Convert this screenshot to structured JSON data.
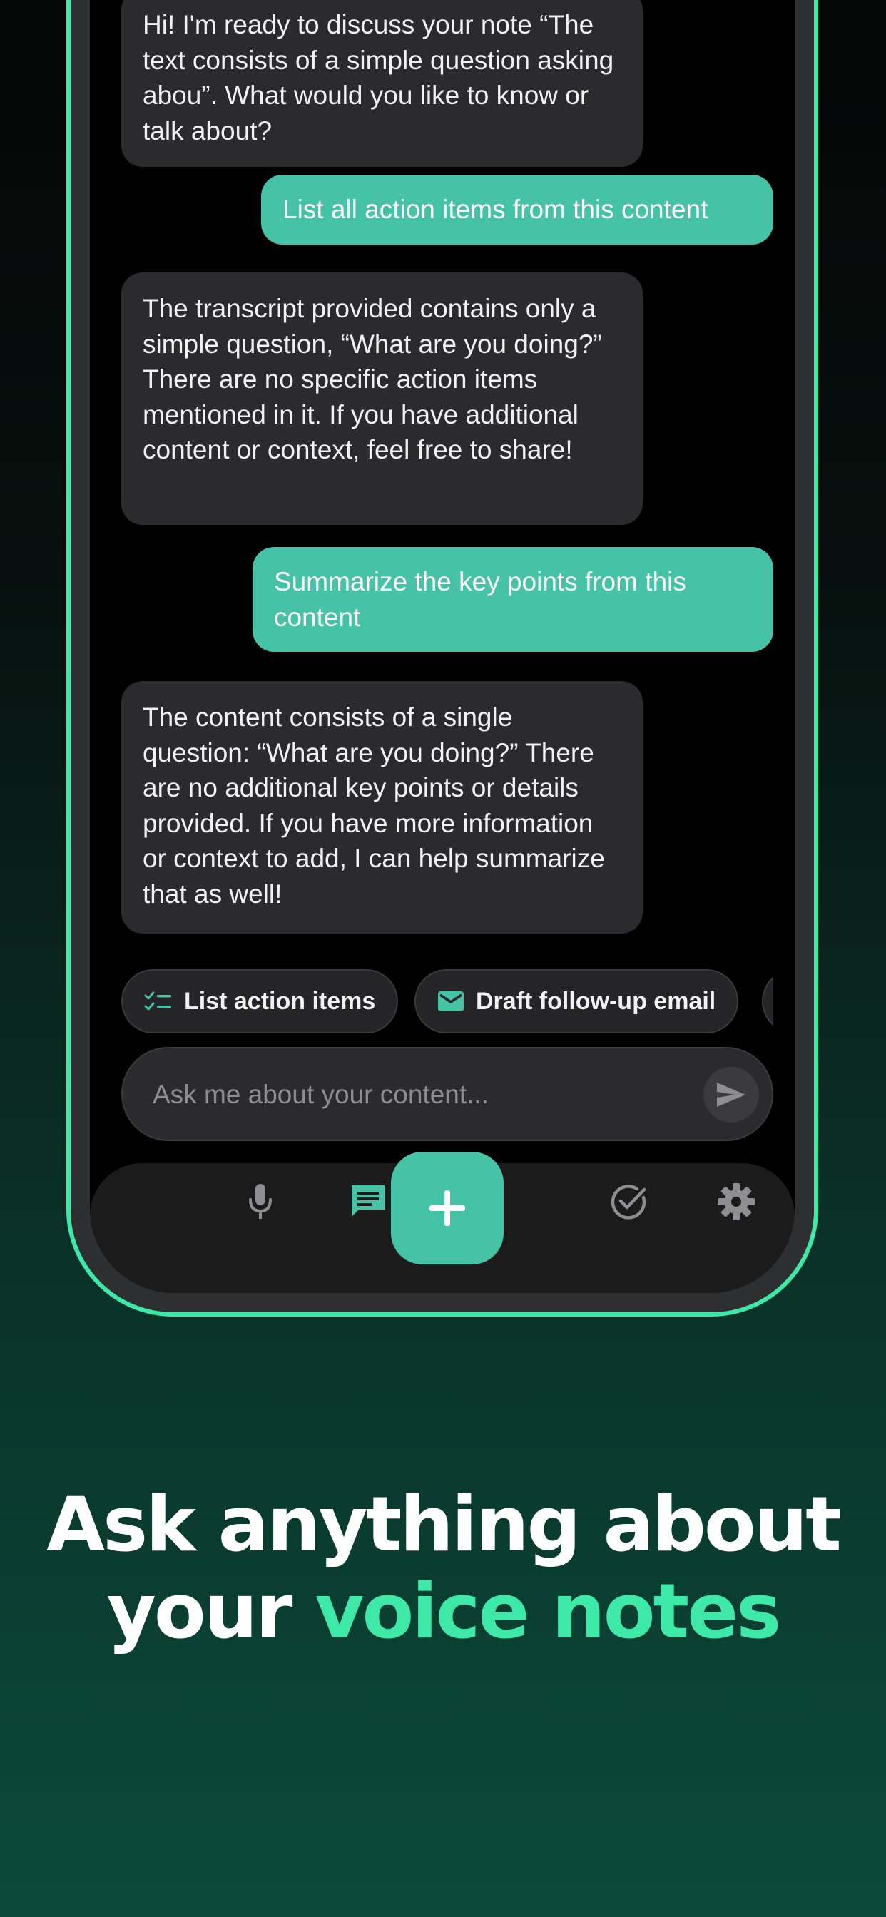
{
  "messages": [
    {
      "role": "assistant",
      "text": "Hi! I'm ready to discuss your note “The text consists of a simple question asking abou”. What would you like to know or talk about?"
    },
    {
      "role": "user",
      "text": "List all action items from this content"
    },
    {
      "role": "assistant",
      "text": "The transcript provided contains only a simple question, “What are you doing?” There are no specific action items mentioned in it. If you have additional content or context, feel free to share!"
    },
    {
      "role": "user",
      "text": "Summarize the key points from this content"
    },
    {
      "role": "assistant",
      "text": "The content consists of a single question: “What are you doing?” There are no additional key points or details provided. If you have more information or context to add, I can help summarize that as well!"
    }
  ],
  "chips": [
    {
      "label": "List action items",
      "icon": "checklist-icon"
    },
    {
      "label": "Draft follow-up email",
      "icon": "mail-icon"
    }
  ],
  "input": {
    "placeholder": "Ask me about your content...",
    "value": ""
  },
  "nav": {
    "items": [
      {
        "icon": "microphone-icon"
      },
      {
        "icon": "chat-icon",
        "active": true
      },
      {
        "icon": "plus-icon"
      },
      {
        "icon": "check-circle-icon"
      },
      {
        "icon": "gear-icon"
      }
    ]
  },
  "headline": {
    "line1": "Ask anything about",
    "line2_prefix": "your ",
    "line2_accent": "voice notes"
  },
  "colors": {
    "accent": "#3ee9a8",
    "user_bubble": "#46c2a6",
    "assistant_bubble": "#2b2b2e",
    "background": "#000000"
  }
}
